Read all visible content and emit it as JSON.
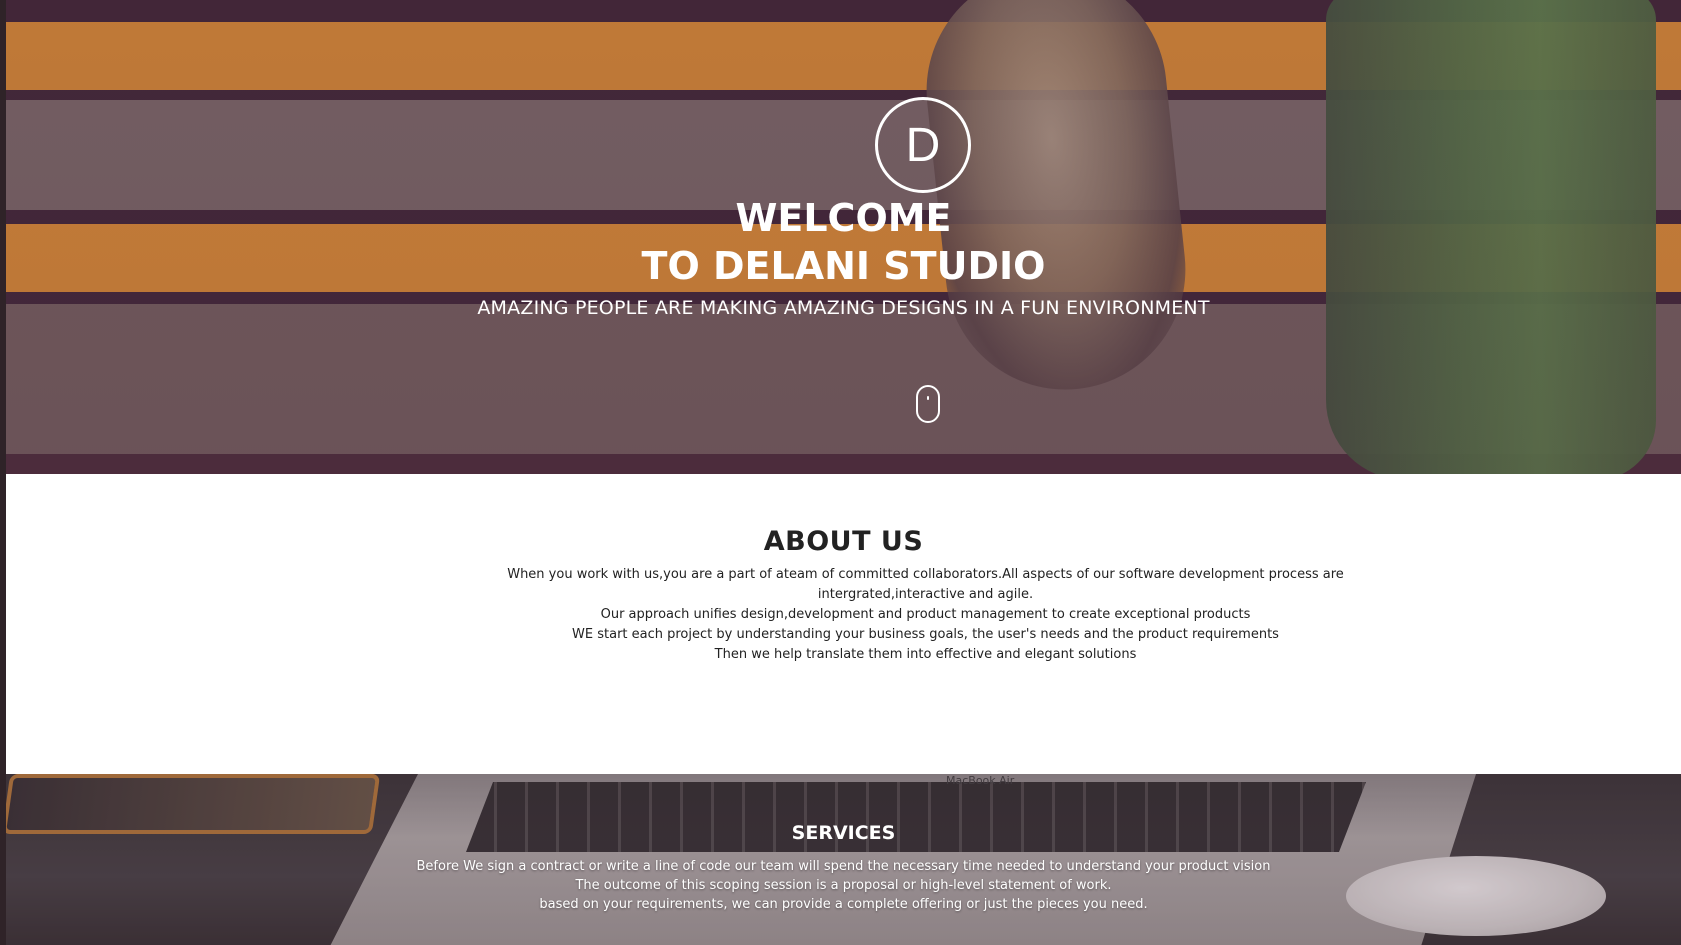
{
  "hero": {
    "logo_letter": "D",
    "title_line1": "WELCOME",
    "title_line2": "TO DELANI STUDIO",
    "subtitle": "AMAZING PEOPLE ARE MAKING AMAZING DESIGNS IN A FUN ENVIRONMENT",
    "scroll_icon": "mouse-icon"
  },
  "about": {
    "heading": "ABOUT US",
    "lines": [
      "When you work with us,you are a part of ateam of committed collaborators.All aspects of our software development process are intergrated,interactive and agile.",
      "Our approach unifies design,development and product management to create exceptional products",
      "WE start each project by understanding your business goals, the user's needs and the product requirements",
      "Then we help translate them into effective and elegant solutions"
    ]
  },
  "services": {
    "heading": "SERVICES",
    "laptop_label": "MacBook Air",
    "lines": [
      "Before We sign a contract or write a line of code our team will spend the necessary time needed to understand your product vision",
      "The outcome of this scoping session is a proposal or high-level statement of work.",
      "based on your requirements, we can provide a complete offering or just the pieces you need."
    ]
  },
  "colors": {
    "hero_overlay": "#5a2850",
    "stair_orange": "#e89a2c",
    "text_dark": "#222222",
    "white": "#ffffff"
  }
}
